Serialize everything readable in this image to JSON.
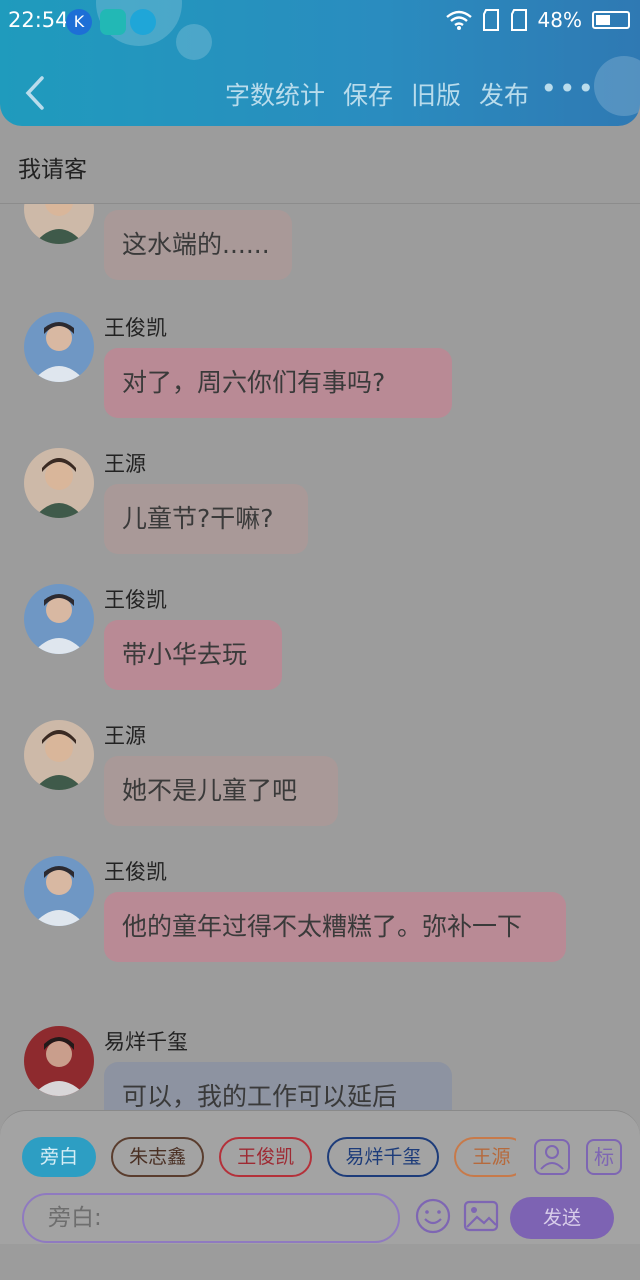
{
  "status": {
    "time": "22:54",
    "battery": "48%",
    "app_icons": [
      "k-app-icon",
      "scan-app-icon",
      "basketball-app-icon"
    ]
  },
  "header": {
    "actions": [
      "字数统计",
      "保存",
      "旧版",
      "发布"
    ],
    "more": "•••"
  },
  "title": "我请客",
  "messages": [
    {
      "name": "",
      "text": "这水端的......",
      "color": "tan",
      "avatar": "wangyuan"
    },
    {
      "name": "王俊凯",
      "text": "对了，周六你们有事吗?",
      "color": "pink",
      "avatar": "wangjunkai"
    },
    {
      "name": "王源",
      "text": "儿童节?干嘛?",
      "color": "tan",
      "avatar": "wangyuan"
    },
    {
      "name": "王俊凯",
      "text": "带小华去玩",
      "color": "pink",
      "avatar": "wangjunkai"
    },
    {
      "name": "王源",
      "text": "她不是儿童了吧",
      "color": "tan",
      "avatar": "wangyuan"
    },
    {
      "name": "王俊凯",
      "text": "他的童年过得不太糟糕了。弥补一下",
      "color": "pink",
      "avatar": "wangjunkai"
    },
    {
      "name": "易烊千玺",
      "text": "可以，我的工作可以延后",
      "color": "blue",
      "avatar": "yiyangqianxi"
    }
  ],
  "roles": [
    {
      "label": "旁白",
      "active": true,
      "color": "#2d9ec3"
    },
    {
      "label": "朱志鑫",
      "active": false,
      "color": "#5a3d2e"
    },
    {
      "label": "王俊凯",
      "active": false,
      "color": "#b4313a"
    },
    {
      "label": "易烊千玺",
      "active": false,
      "color": "#1d3c7a"
    },
    {
      "label": "王源",
      "active": false,
      "color": "#c77a4a"
    }
  ],
  "input": {
    "placeholder": "旁白:"
  },
  "buttons": {
    "mark": "标",
    "send": "发送"
  }
}
